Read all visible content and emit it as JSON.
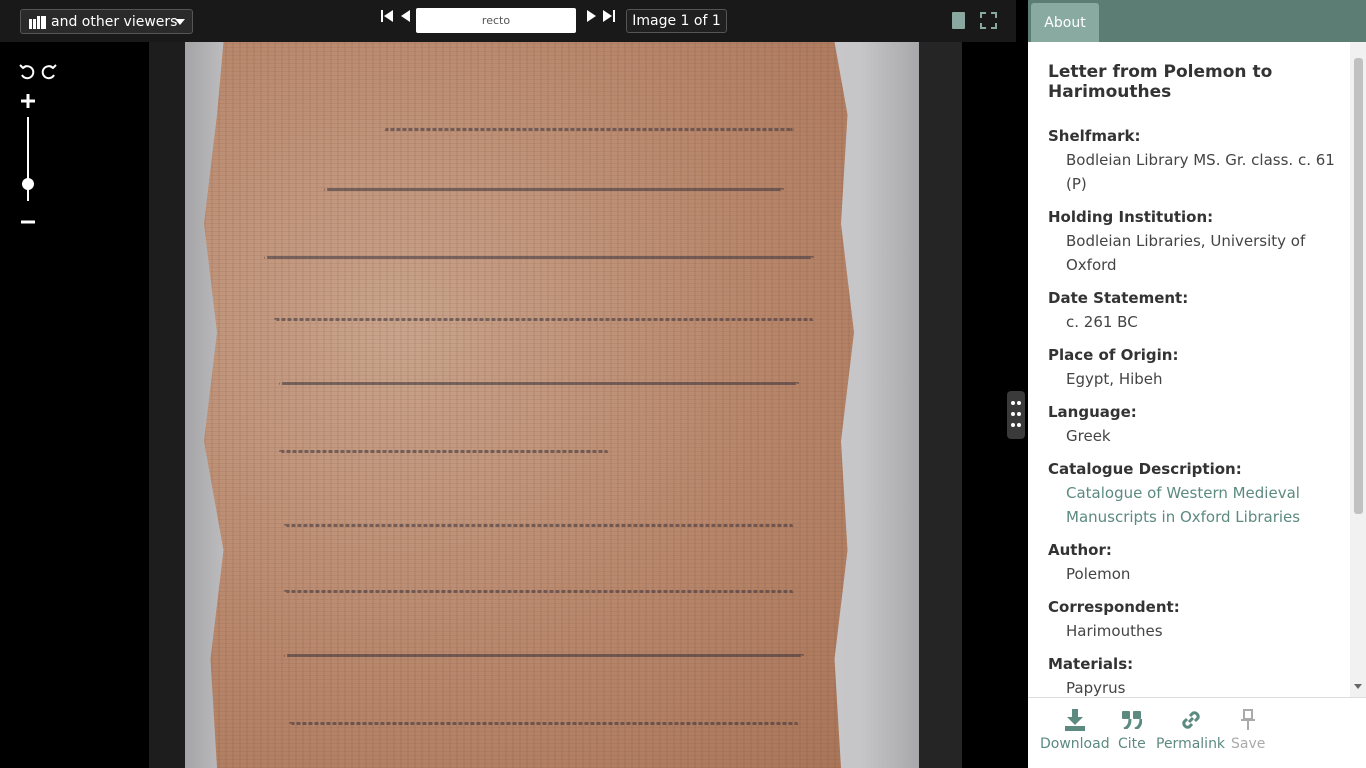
{
  "toolbar": {
    "viewers_label": "and other viewers",
    "page_input_value": "recto",
    "image_count": "Image 1 of 1"
  },
  "panel": {
    "tab_about": "About",
    "title": "Letter from Polemon to Harimouthes",
    "fields": [
      {
        "label": "Shelfmark:",
        "value": "Bodleian Library MS. Gr. class. c. 61 (P)"
      },
      {
        "label": "Holding Institution:",
        "value": "Bodleian Libraries, University of Oxford"
      },
      {
        "label": "Date Statement:",
        "value": "c. 261 BC"
      },
      {
        "label": "Place of Origin:",
        "value": "Egypt, Hibeh"
      },
      {
        "label": "Language:",
        "value": "Greek"
      },
      {
        "label": "Catalogue Description:",
        "value": "Catalogue of Western Medieval Manuscripts in Oxford Libraries"
      },
      {
        "label": "Author:",
        "value": "Polemon"
      },
      {
        "label": "Correspondent:",
        "value": "Harimouthes"
      },
      {
        "label": "Materials:",
        "value": "Papyrus"
      }
    ]
  },
  "actions": {
    "download": "Download",
    "cite": "Cite",
    "permalink": "Permalink",
    "save": "Save"
  },
  "colors": {
    "accent": "#5c7d74",
    "tab_active": "#89aaa1",
    "link": "#5c8a80"
  },
  "icons": [
    "iiif-logo",
    "first-page-icon",
    "prev-page-icon",
    "next-page-icon",
    "last-page-icon",
    "single-page-view-icon",
    "fullscreen-icon",
    "rotate-left-icon",
    "rotate-right-icon",
    "zoom-in-icon",
    "zoom-out-icon",
    "download-icon",
    "quote-icon",
    "link-icon",
    "pin-icon"
  ]
}
